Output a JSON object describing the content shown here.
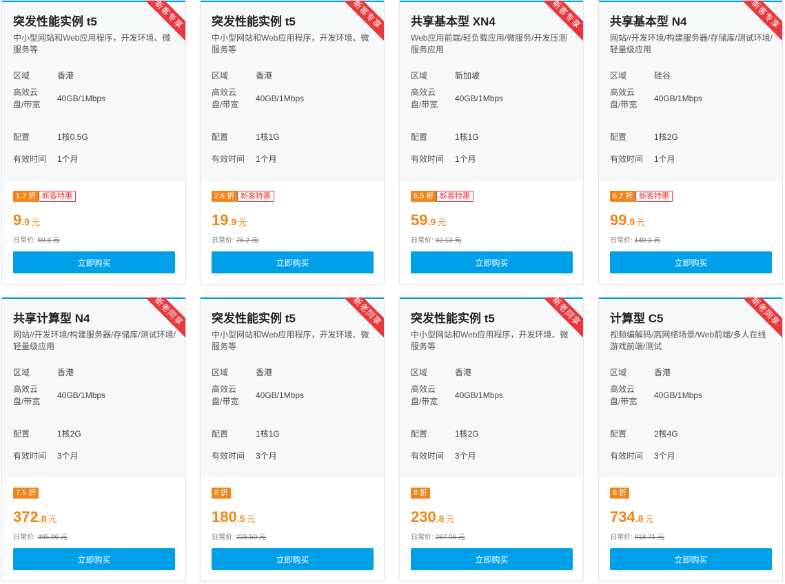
{
  "labels": {
    "region": "区域",
    "disk_line1": "高效云",
    "disk_line2": "盘/带宽",
    "config": "配置",
    "validity": "有效时间",
    "orig_prefix": "日常价:",
    "unit": "元",
    "buy": "立即购买",
    "new_customer_tag": "新客特惠"
  },
  "colors": {
    "accent": "#00a0e9",
    "price": "#f08519",
    "ribbon": "#e8383d"
  },
  "cards": [
    {
      "ribbon": "新客专享",
      "title": "突发性能实例 t5",
      "desc": "中小型网站和Web应用程序，开发环境、微服务等",
      "region": "香港",
      "disk": "40GB/1Mbps",
      "config": "1核0.5G",
      "validity": "1个月",
      "discount": "1.7 折",
      "new_tag": true,
      "price_int": "9",
      "price_dec": ".9",
      "orig_price": "59.8 元"
    },
    {
      "ribbon": "新客专享",
      "title": "突发性能实例 t5",
      "desc": "中小型网站和Web应用程序，开发环境、微服务等",
      "region": "香港",
      "disk": "40GB/1Mbps",
      "config": "1核1G",
      "validity": "1个月",
      "discount": "2.6 折",
      "new_tag": true,
      "price_int": "19",
      "price_dec": ".9",
      "orig_price": "75.2 元"
    },
    {
      "ribbon": "新客专享",
      "title": "共享基本型 XN4",
      "desc": "Web应用前端/轻负载应用/微服务/开发压测服务应用",
      "region": "新加坡",
      "disk": "40GB/1Mbps",
      "config": "1核1G",
      "validity": "1个月",
      "discount": "6.5 折",
      "new_tag": true,
      "price_int": "59",
      "price_dec": ".9",
      "orig_price": "92.13 元"
    },
    {
      "ribbon": "新客专享",
      "title": "共享基本型 N4",
      "desc": "网站//开发环境/构建服务器/存储库/测试环境/轻量级应用",
      "region": "硅谷",
      "disk": "40GB/1Mbps",
      "config": "1核2G",
      "validity": "1个月",
      "discount": "6.7 折",
      "new_tag": true,
      "price_int": "99",
      "price_dec": ".9",
      "orig_price": "149.3 元"
    },
    {
      "ribbon": "新老同享",
      "title": "共享计算型 N4",
      "desc": "网站//开发环境/构建服务器/存储库/测试环境/轻量级应用",
      "region": "香港",
      "disk": "40GB/1Mbps",
      "config": "1核2G",
      "validity": "3个月",
      "discount": "7.5 折",
      "new_tag": false,
      "price_int": "372",
      "price_dec": ".8",
      "orig_price": "495.96 元"
    },
    {
      "ribbon": "新老同享",
      "title": "突发性能实例 t5",
      "desc": "中小型网站和Web应用程序，开发环境、微服务等",
      "region": "香港",
      "disk": "40GB/1Mbps",
      "config": "1核1G",
      "validity": "3个月",
      "discount": "8 折",
      "new_tag": false,
      "price_int": "180",
      "price_dec": ".5",
      "orig_price": "225.59 元"
    },
    {
      "ribbon": "新老同享",
      "title": "突发性能实例 t5",
      "desc": "中小型网站和Web应用程序，开发环境、微服务等",
      "region": "香港",
      "disk": "40GB/1Mbps",
      "config": "1核2G",
      "validity": "3个月",
      "discount": "8 折",
      "new_tag": false,
      "price_int": "230",
      "price_dec": ".8",
      "orig_price": "287.06 元"
    },
    {
      "ribbon": "新老同享",
      "title": "计算型 C5",
      "desc": "视频编解码/高网络场景/Web前端/多人在线游戏前端/测试",
      "region": "香港",
      "disk": "40GB/1Mbps",
      "config": "2核4G",
      "validity": "3个月",
      "discount": "8 折",
      "new_tag": false,
      "price_int": "734",
      "price_dec": ".8",
      "orig_price": "918.71 元"
    }
  ]
}
